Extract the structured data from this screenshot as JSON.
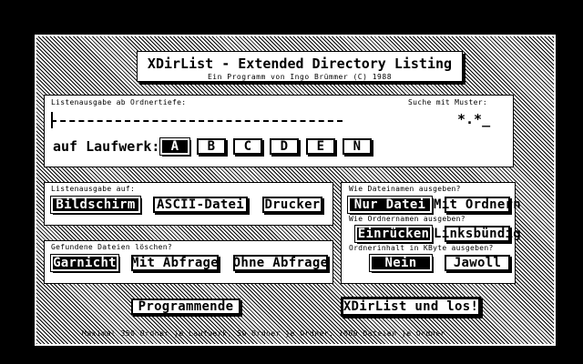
{
  "title": {
    "main": "XDirList - Extended Directory Listing",
    "sub": "Ein Programm von Ingo Brümmer (C) 1988"
  },
  "search": {
    "depth_label": "Listenausgabe ab Ordnertiefe:",
    "pattern_label": "Suche mit Muster:",
    "pattern_value": "*.*_",
    "drive_label": "auf Laufwerk:",
    "drives": [
      "A",
      "B",
      "C",
      "D",
      "E",
      "N"
    ],
    "drive_selected": "A"
  },
  "output": {
    "label": "Listenausgabe auf:",
    "options": [
      "Bildschirm",
      "ASCII-Datei",
      "Drucker"
    ],
    "selected": "Bildschirm"
  },
  "delete": {
    "label": "Gefundene Dateien löschen?",
    "options": [
      "Garnicht",
      "Mit Abfrage",
      "Ohne Abfrage"
    ],
    "selected": "Garnicht"
  },
  "filenames": {
    "label": "Wie Dateinamen ausgeben?",
    "options": [
      "Nur Datei",
      "Mit Ordnern"
    ],
    "selected": "Nur Datei"
  },
  "foldernames": {
    "label": "Wie Ordnernamen ausgeben?",
    "options": [
      "Einrücken",
      "Linksbündig"
    ],
    "selected": "Einrücken"
  },
  "kbyte": {
    "label": "Ordnerinhalt in KByte ausgeben?",
    "options": [
      "Nein",
      "Jawoll"
    ],
    "selected": "Nein"
  },
  "actions": {
    "quit": "Programmende",
    "run": "XDirList und los!"
  },
  "status": "Maximal 350 Ordner je Laufwerk, 50 Ordner je Ordner, 1000 Dateien je Ordner"
}
